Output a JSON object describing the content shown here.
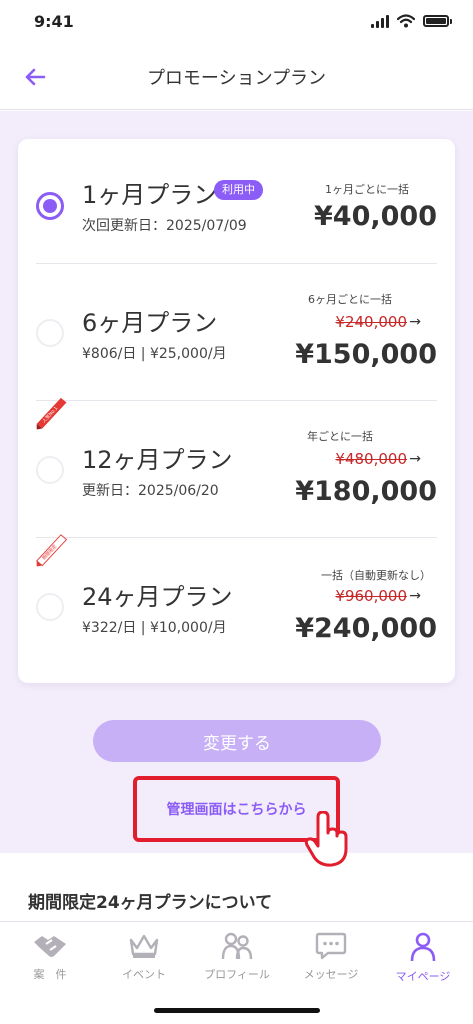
{
  "status_bar": {
    "time": "9:41"
  },
  "header": {
    "title": "プロモーションプラン",
    "back_icon": "arrow-left-icon"
  },
  "plans": [
    {
      "name": "1ヶ月プラン",
      "badge": "利用中",
      "sub": "次回更新日：2025/07/09",
      "billing": "1ヶ月ごとに一括",
      "old_price": "",
      "price": "¥40,000",
      "selected": true,
      "ribbon": ""
    },
    {
      "name": "6ヶ月プラン",
      "badge": "",
      "sub": "¥806/日 | ¥25,000/月",
      "billing": "6ヶ月ごとに一括",
      "old_price": "¥240,000",
      "price": "¥150,000",
      "selected": false,
      "ribbon": ""
    },
    {
      "name": "12ヶ月プラン",
      "badge": "",
      "sub": "更新日：2025/06/20",
      "billing": "年ごとに一括",
      "old_price": "¥480,000",
      "price": "¥180,000",
      "selected": false,
      "ribbon": "人気No.1"
    },
    {
      "name": "24ヶ月プラン",
      "badge": "",
      "sub": "¥322/日 | ¥10,000/月",
      "billing": "一括（自動更新なし）",
      "old_price": "¥960,000",
      "price": "¥240,000",
      "selected": false,
      "ribbon": "期間限定"
    }
  ],
  "price_arrow": "→",
  "change_button": "変更する",
  "admin_link": "管理画面はこちらから",
  "section_title": "期間限定24ヶ月プランについて",
  "tabs": [
    {
      "label": "案　件",
      "icon": "handshake-icon",
      "active": false
    },
    {
      "label": "イベント",
      "icon": "crown-icon",
      "active": false
    },
    {
      "label": "プロフィール",
      "icon": "people-icon",
      "active": false
    },
    {
      "label": "メッセージ",
      "icon": "message-icon",
      "active": false
    },
    {
      "label": "マイページ",
      "icon": "person-icon",
      "active": true
    }
  ],
  "colors": {
    "accent": "#8b5cf6",
    "accent_light": "#c7b0f6",
    "background": "#f3edfb",
    "strike": "#c62828",
    "highlight": "#e11d2e"
  }
}
